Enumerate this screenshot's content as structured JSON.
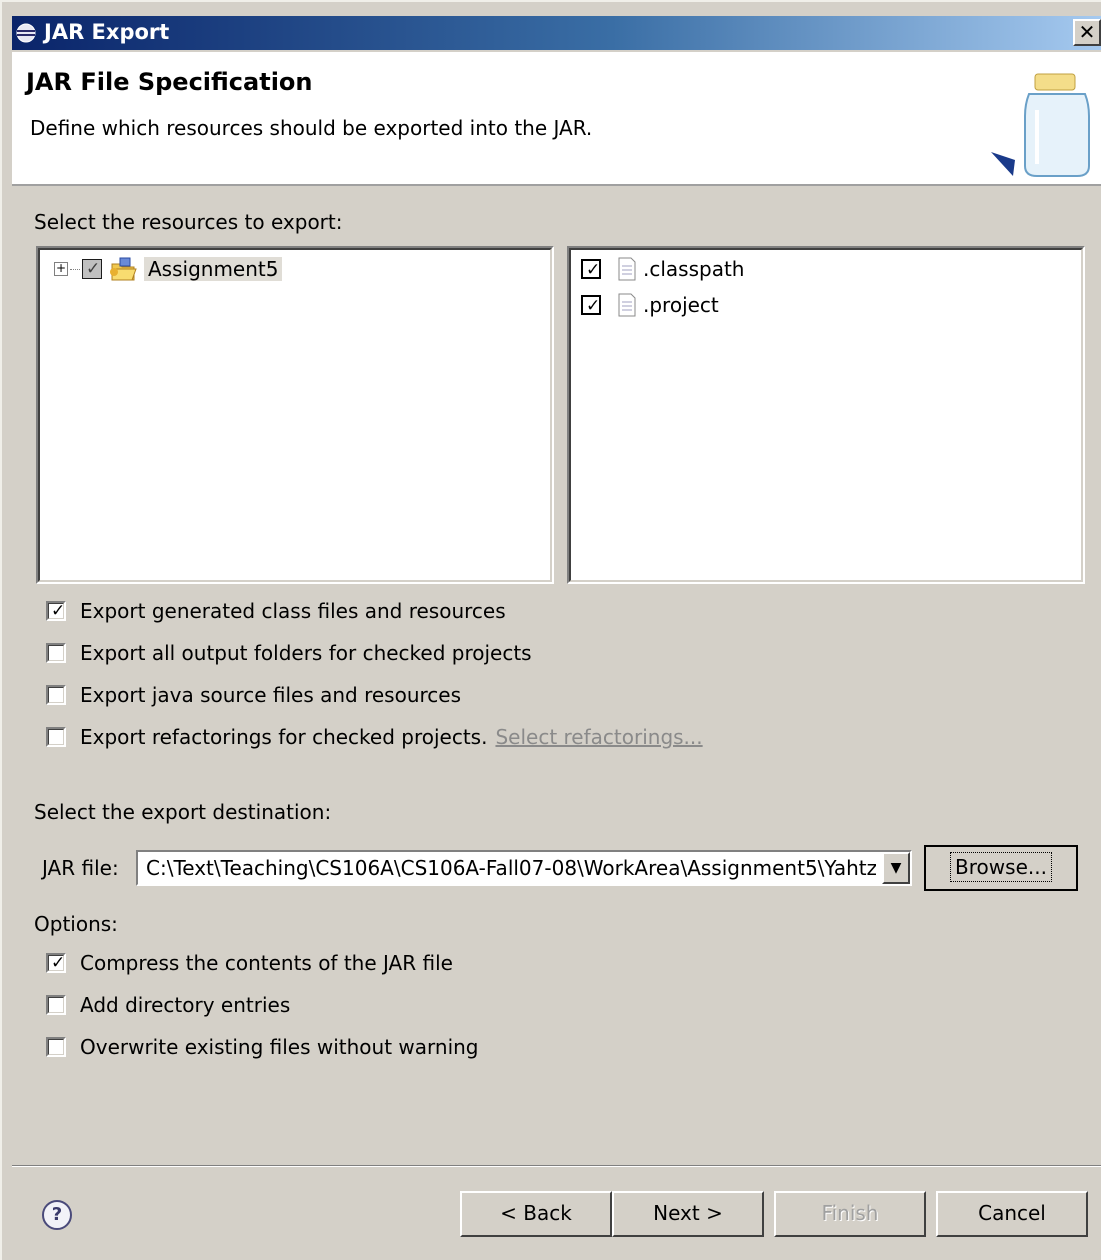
{
  "window": {
    "title": "JAR Export",
    "close_label": "✕"
  },
  "banner": {
    "title": "JAR File Specification",
    "description": "Define which resources should be exported into the JAR."
  },
  "resources": {
    "label": "Select the resources to export:",
    "tree": [
      {
        "label": "Assignment5",
        "expander": "+",
        "state": "partial"
      }
    ],
    "files": [
      {
        "label": ".classpath",
        "checked": true
      },
      {
        "label": ".project",
        "checked": true
      }
    ]
  },
  "export_options": [
    {
      "label": "Export generated class files and resources",
      "checked": true
    },
    {
      "label": "Export all output folders for checked projects",
      "checked": false
    },
    {
      "label": "Export java source files and resources",
      "checked": false
    },
    {
      "label": "Export refactorings for checked projects.",
      "checked": false,
      "link": "Select refactorings..."
    }
  ],
  "destination": {
    "label": "Select the export destination:",
    "jar_label": "JAR file:",
    "jar_value": "C:\\Text\\Teaching\\CS106A\\CS106A-Fall07-08\\WorkArea\\Assignment5\\Yahtz",
    "browse_label": "Browse..."
  },
  "options": {
    "label": "Options:",
    "items": [
      {
        "label": "Compress the contents of the JAR file",
        "checked": true
      },
      {
        "label": "Add directory entries",
        "checked": false
      },
      {
        "label": "Overwrite existing files without warning",
        "checked": false
      }
    ]
  },
  "footer": {
    "help": "?",
    "back": "< Back",
    "next": "Next >",
    "finish": "Finish",
    "cancel": "Cancel"
  },
  "colors": {
    "titlebar_start": "#0a246a",
    "titlebar_end": "#a6caf0",
    "dialog_bg": "#d4d0c8"
  }
}
